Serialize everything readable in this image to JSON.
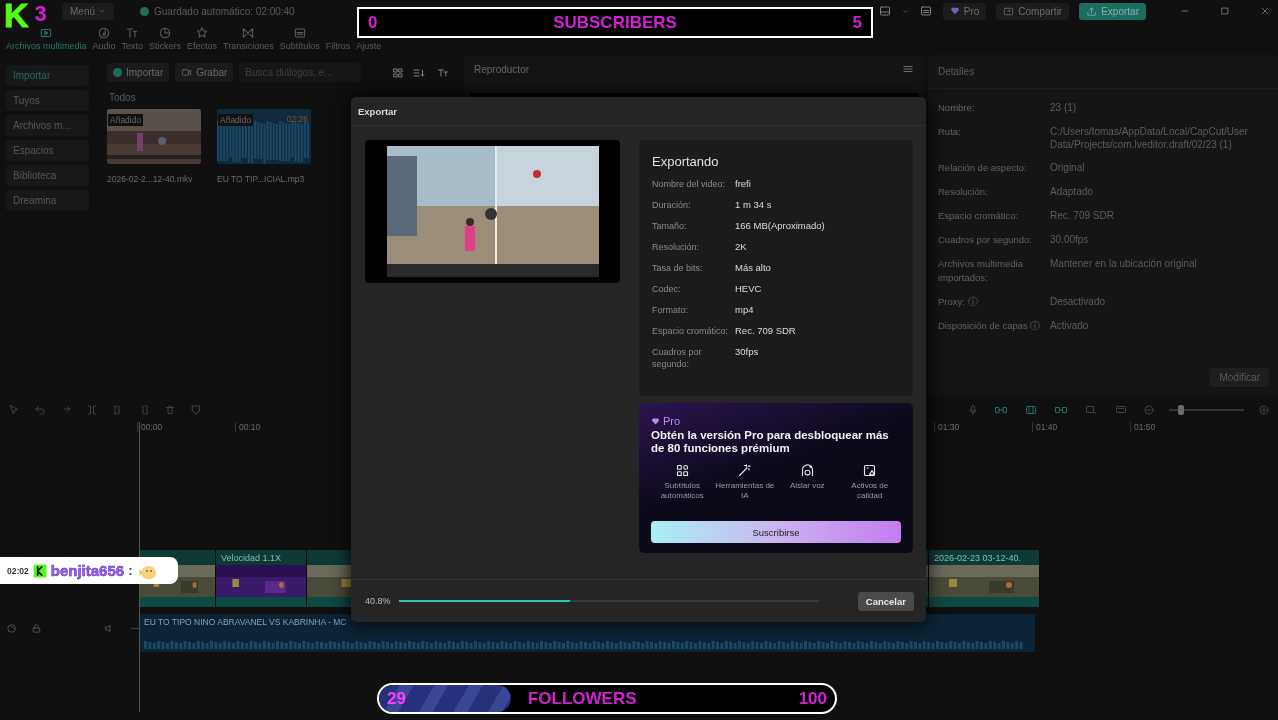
{
  "top_bar": {
    "menu": "Menú",
    "autosave": "Guardado automático: 02:00:40",
    "buttons": [
      {
        "label": "Pro",
        "kind": "pro"
      },
      {
        "label": "Compartir",
        "kind": "share"
      },
      {
        "label": "Exportar",
        "kind": "export"
      }
    ]
  },
  "tool_tabs": [
    {
      "label": "Archivos multimedia",
      "selected": true
    },
    {
      "label": "Audio",
      "selected": false
    },
    {
      "label": "Texto",
      "selected": false
    },
    {
      "label": "Stickers",
      "selected": false
    },
    {
      "label": "Efectos",
      "selected": false
    },
    {
      "label": "Transiciones",
      "selected": false
    },
    {
      "label": "Subtítulos",
      "selected": false
    },
    {
      "label": "Filtros",
      "selected": false
    },
    {
      "label": "Ajuste",
      "selected": false
    }
  ],
  "media_panel": {
    "nav": [
      {
        "label": "Importar",
        "selected": true
      },
      {
        "label": "Tuyos",
        "selected": false
      },
      {
        "label": "Archivos m...",
        "selected": false
      },
      {
        "label": "Espacios",
        "selected": false
      },
      {
        "label": "Biblioteca",
        "selected": false
      },
      {
        "label": "Dreamina",
        "selected": false
      }
    ],
    "import_button": "Importar",
    "record_button": "Grabar",
    "search": {
      "placeholder": "Busca diálogos, e..."
    },
    "section": "Todos",
    "items": [
      {
        "kind": "video",
        "badge": "Añadido",
        "name": "2026-02-2...12-40.mkv"
      },
      {
        "kind": "audio",
        "badge": "Añadido",
        "duration": "02:26",
        "name": "EU TO TIP...ICIAL.mp3"
      }
    ]
  },
  "player": {
    "title": "Reproductor"
  },
  "details": {
    "title": "Detalles",
    "rows": [
      {
        "label": "Nombre:",
        "value": "23 (1)"
      },
      {
        "label": "Ruta:",
        "value": "C:/Users/tomas/AppData/Local/CapCut/User Data/Projects/com.lveditor.draft/02/23 (1)"
      },
      {
        "label": "Relación de aspecto:",
        "value": "Original"
      },
      {
        "label": "Resolución:",
        "value": "Adaptado"
      },
      {
        "label": "Espacio cromático:",
        "value": "Rec. 709 SDR"
      },
      {
        "label": "Cuadros por segundo:",
        "value": "30.00fps"
      },
      {
        "label": "Archivos multimedia importados:",
        "value": "Mantener en la ubicación original"
      },
      {
        "label": "Proxy: ⓘ",
        "value": "Desactivado"
      },
      {
        "label": "Disposición de capas ⓘ",
        "value": "Activado"
      }
    ],
    "modify_button": "Modificar"
  },
  "timeline": {
    "left_ticks": [
      "00:00",
      "00:10"
    ],
    "right_ticks": [
      "01:30",
      "01:40",
      "01:50"
    ],
    "zoom": {
      "level": 0.16
    },
    "video_clips": [
      {
        "label": "Velocidad 1.1X"
      },
      {
        "label": "2026-02-23 03-12-40."
      }
    ],
    "audio_clip": "EU TO TIPO NINO ABRAVANEL VS KABRINHA - MC"
  },
  "export_dialog": {
    "title": "Exportar",
    "info": {
      "title": "Exportando",
      "rows": [
        {
          "label": "Nombre del video:",
          "value": "frefi"
        },
        {
          "label": "Duración:",
          "value": "1 m 34 s"
        },
        {
          "label": "Tamaño:",
          "value": "166 MB(Aproximado)"
        },
        {
          "label": "Resolución:",
          "value": "2K"
        },
        {
          "label": "Tasa de bits:",
          "value": "Más alto"
        },
        {
          "label": "Codec:",
          "value": "HEVC"
        },
        {
          "label": "Formato:",
          "value": "mp4"
        },
        {
          "label": "Espacio cromático:",
          "value": "Rec. 709 SDR"
        },
        {
          "label": "Cuadros por segundo:",
          "value": "30fps"
        }
      ]
    },
    "pro": {
      "badge": "Pro",
      "headline": "Obtén la versión Pro para desbloquear más de 80 funciones prémium",
      "features": [
        "Subtítulos automáticos",
        "Herramientas de IA",
        "Aislar voz",
        "Activos de calidad"
      ],
      "button": "Suscribirse"
    },
    "progress": {
      "reading": "40.8%",
      "level": 0.408
    },
    "cancel_button": "Cancelar"
  },
  "overlays": {
    "logo": {
      "letter": "K",
      "number": "3"
    },
    "subscribers": {
      "current": "0",
      "label": "SUBSCRIBERS",
      "goal": "5"
    },
    "followers": {
      "current": "29",
      "label": "FOLLOWERS",
      "goal": "100",
      "level": 0.29
    },
    "chat": {
      "time": "02:02",
      "user": "benjita656",
      "separator": ":"
    }
  }
}
